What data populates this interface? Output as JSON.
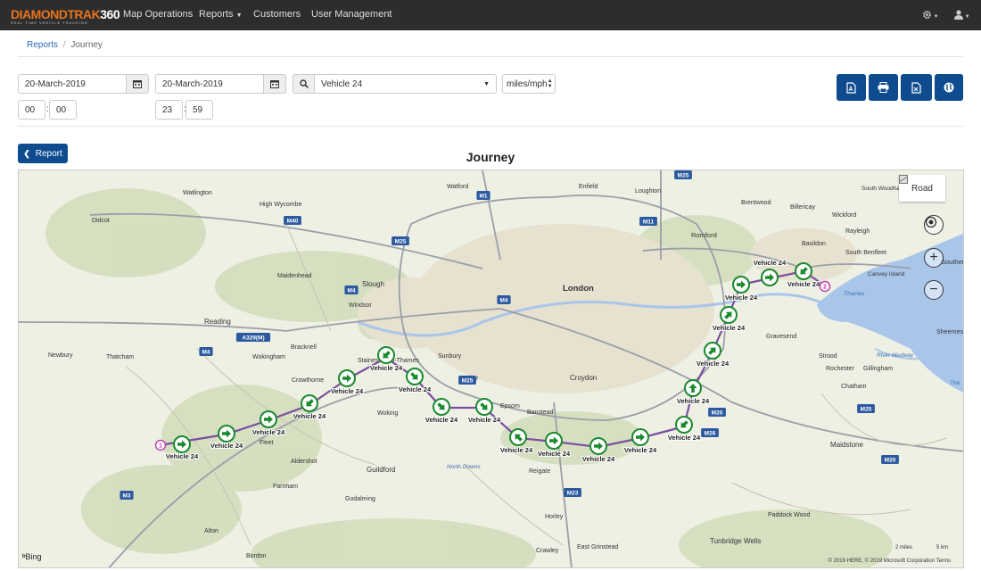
{
  "app": {
    "logo_main": "DIAMONDTRAK",
    "logo_num": "360",
    "logo_tagline": "REAL TIME VEHICLE TRACKING"
  },
  "nav": {
    "items": [
      {
        "label": "Map Operations"
      },
      {
        "label": "Reports"
      },
      {
        "label": "Customers"
      },
      {
        "label": "User Management"
      }
    ],
    "settings_icon": "gear-icon",
    "user_icon": "user-icon"
  },
  "breadcrumb": {
    "root": "Reports",
    "sep": "/",
    "current": "Journey"
  },
  "filters": {
    "start_date": "20-March-2019",
    "end_date": "20-March-2019",
    "vehicle": "Vehicle 24",
    "units": "miles/mph",
    "start_hour": "00",
    "start_minute": "00",
    "end_hour": "23",
    "end_minute": "59"
  },
  "toolbar": {
    "icons": [
      "pdf-icon",
      "print-icon",
      "excel-icon",
      "globe-icon"
    ]
  },
  "report_button": "Report",
  "title": "Journey",
  "map": {
    "road_label": "Road",
    "bing_label": "Bing",
    "copyright": "© 2019 HERE, © 2019 Microsoft Corporation  Terms",
    "scale_miles": "2 miles",
    "scale_km": "5 km",
    "places": [
      {
        "name": "Watlington"
      },
      {
        "name": "Watford"
      },
      {
        "name": "Enfield"
      },
      {
        "name": "Loughton"
      },
      {
        "name": "High Wycombe"
      },
      {
        "name": "Didcot"
      },
      {
        "name": "Brentwood"
      },
      {
        "name": "Billericay"
      },
      {
        "name": "South Woodham Ferrers"
      },
      {
        "name": "Wickford"
      },
      {
        "name": "Romford"
      },
      {
        "name": "Rayleigh"
      },
      {
        "name": "Basildon"
      },
      {
        "name": "South Benfleet"
      },
      {
        "name": "Southend"
      },
      {
        "name": "Canvey Island"
      },
      {
        "name": "Maidenhead"
      },
      {
        "name": "Slough"
      },
      {
        "name": "London"
      },
      {
        "name": "Windsor"
      },
      {
        "name": "Reading"
      },
      {
        "name": "Thames"
      },
      {
        "name": "Sheerness"
      },
      {
        "name": "Gravesend"
      },
      {
        "name": "Bracknell"
      },
      {
        "name": "Staines-upon-Thames"
      },
      {
        "name": "Sunbury"
      },
      {
        "name": "Wokingham"
      },
      {
        "name": "Newbury"
      },
      {
        "name": "Thatcham"
      },
      {
        "name": "Crowthorne"
      },
      {
        "name": "Esher"
      },
      {
        "name": "Croydon"
      },
      {
        "name": "Strood"
      },
      {
        "name": "Rochester"
      },
      {
        "name": "Gillingham"
      },
      {
        "name": "River Medway"
      },
      {
        "name": "Chatham"
      },
      {
        "name": "Woking"
      },
      {
        "name": "Epsom"
      },
      {
        "name": "Banstead"
      },
      {
        "name": "Fleet"
      },
      {
        "name": "Maidstone"
      },
      {
        "name": "Aldershot"
      },
      {
        "name": "Guildford"
      },
      {
        "name": "North Downs"
      },
      {
        "name": "Reigate"
      },
      {
        "name": "Farnham"
      },
      {
        "name": "Godalming"
      },
      {
        "name": "Horley"
      },
      {
        "name": "Paddock Wood"
      },
      {
        "name": "Alton"
      },
      {
        "name": "Crawley"
      },
      {
        "name": "East Grinstead"
      },
      {
        "name": "Tunbridge Wells"
      },
      {
        "name": "Bordon"
      },
      {
        "name": "The"
      }
    ],
    "roads": [
      "M1",
      "M25",
      "M11",
      "M40",
      "M25",
      "M4",
      "M4",
      "A329(M)",
      "M4",
      "M25",
      "M20",
      "M26",
      "M20",
      "M3",
      "M23",
      "M25"
    ],
    "vehicle_label": "Vehicle 24",
    "markers": [
      {
        "dir": "W"
      },
      {
        "dir": "W"
      },
      {
        "dir": "W"
      },
      {
        "dir": "NE"
      },
      {
        "dir": "W"
      },
      {
        "dir": "NE"
      },
      {
        "dir": "NW"
      },
      {
        "dir": "NW"
      },
      {
        "dir": "NW"
      },
      {
        "dir": "SE"
      },
      {
        "dir": "W"
      },
      {
        "dir": "W"
      },
      {
        "dir": "W"
      },
      {
        "dir": "NE"
      },
      {
        "dir": "S"
      },
      {
        "dir": "SW"
      },
      {
        "dir": "SW"
      },
      {
        "dir": "W"
      },
      {
        "dir": "W"
      },
      {
        "dir": "NE"
      }
    ],
    "waypoints": [
      {
        "label": "1"
      },
      {
        "label": "2"
      }
    ]
  }
}
